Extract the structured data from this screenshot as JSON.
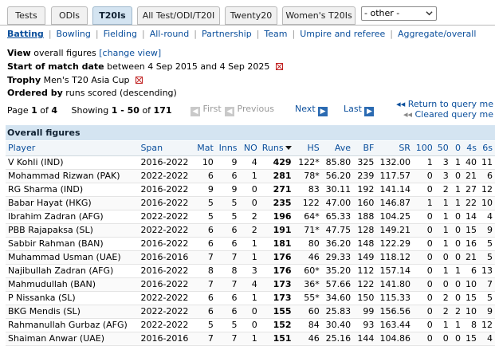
{
  "tabs": [
    {
      "label": "Tests",
      "active": false
    },
    {
      "label": "ODIs",
      "active": false
    },
    {
      "label": "T20Is",
      "active": true
    },
    {
      "label": "All Test/ODI/T20I",
      "active": false
    },
    {
      "label": "Twenty20",
      "active": false
    },
    {
      "label": "Women's T20Is",
      "active": false
    }
  ],
  "other_select": {
    "value": "- other -"
  },
  "subnav": [
    "Batting",
    "Bowling",
    "Fielding",
    "All-round",
    "Partnership",
    "Team",
    "Umpire and referee",
    "Aggregate/overall"
  ],
  "filters": {
    "view_label": "View",
    "view_value": "overall figures",
    "change_view": "[change view]",
    "start_label": "Start of match date",
    "start_value": "between 4 Sep 2015 and 4 Sep 2025",
    "trophy_label": "Trophy",
    "trophy_value": "Men's T20 Asia Cup",
    "ordered_label": "Ordered by",
    "ordered_value": "runs scored (descending)"
  },
  "pager": {
    "page_word": "Page",
    "page": "1",
    "of_word": "of",
    "pages": "4",
    "showing_word": "Showing",
    "range": "1 - 50",
    "total": "171",
    "first": "First",
    "previous": "Previous",
    "next": "Next",
    "last": "Last",
    "return_query": "Return to query me",
    "cleared_query": "Cleared query me"
  },
  "table": {
    "title": "Overall figures",
    "columns": [
      "Player",
      "Span",
      "Mat",
      "Inns",
      "NO",
      "Runs",
      "HS",
      "Ave",
      "BF",
      "SR",
      "100",
      "50",
      "0",
      "4s",
      "6s"
    ],
    "rows": [
      [
        "V Kohli (IND)",
        "2016-2022",
        "10",
        "9",
        "4",
        "429",
        "122*",
        "85.80",
        "325",
        "132.00",
        "1",
        "3",
        "1",
        "40",
        "11"
      ],
      [
        "Mohammad Rizwan (PAK)",
        "2022-2022",
        "6",
        "6",
        "1",
        "281",
        "78*",
        "56.20",
        "239",
        "117.57",
        "0",
        "3",
        "0",
        "21",
        "6"
      ],
      [
        "RG Sharma (IND)",
        "2016-2022",
        "9",
        "9",
        "0",
        "271",
        "83",
        "30.11",
        "192",
        "141.14",
        "0",
        "2",
        "1",
        "27",
        "12"
      ],
      [
        "Babar Hayat (HKG)",
        "2016-2022",
        "5",
        "5",
        "0",
        "235",
        "122",
        "47.00",
        "160",
        "146.87",
        "1",
        "1",
        "1",
        "22",
        "10"
      ],
      [
        "Ibrahim Zadran (AFG)",
        "2022-2022",
        "5",
        "5",
        "2",
        "196",
        "64*",
        "65.33",
        "188",
        "104.25",
        "0",
        "1",
        "0",
        "14",
        "4"
      ],
      [
        "PBB Rajapaksa (SL)",
        "2022-2022",
        "6",
        "6",
        "2",
        "191",
        "71*",
        "47.75",
        "128",
        "149.21",
        "0",
        "1",
        "0",
        "15",
        "9"
      ],
      [
        "Sabbir Rahman (BAN)",
        "2016-2022",
        "6",
        "6",
        "1",
        "181",
        "80",
        "36.20",
        "148",
        "122.29",
        "0",
        "1",
        "0",
        "16",
        "5"
      ],
      [
        "Muhammad Usman (UAE)",
        "2016-2016",
        "7",
        "7",
        "1",
        "176",
        "46",
        "29.33",
        "149",
        "118.12",
        "0",
        "0",
        "0",
        "21",
        "5"
      ],
      [
        "Najibullah Zadran (AFG)",
        "2016-2022",
        "8",
        "8",
        "3",
        "176",
        "60*",
        "35.20",
        "112",
        "157.14",
        "0",
        "1",
        "1",
        "6",
        "13"
      ],
      [
        "Mahmudullah (BAN)",
        "2016-2022",
        "7",
        "7",
        "4",
        "173",
        "36*",
        "57.66",
        "122",
        "141.80",
        "0",
        "0",
        "0",
        "10",
        "7"
      ],
      [
        "P Nissanka (SL)",
        "2022-2022",
        "6",
        "6",
        "1",
        "173",
        "55*",
        "34.60",
        "150",
        "115.33",
        "0",
        "2",
        "0",
        "15",
        "5"
      ],
      [
        "BKG Mendis (SL)",
        "2022-2022",
        "6",
        "6",
        "0",
        "155",
        "60",
        "25.83",
        "99",
        "156.56",
        "0",
        "2",
        "2",
        "10",
        "9"
      ],
      [
        "Rahmanullah Gurbaz (AFG)",
        "2022-2022",
        "5",
        "5",
        "0",
        "152",
        "84",
        "30.40",
        "93",
        "163.44",
        "0",
        "1",
        "1",
        "8",
        "12"
      ],
      [
        "Shaiman Anwar (UAE)",
        "2016-2016",
        "7",
        "7",
        "1",
        "151",
        "46",
        "25.16",
        "144",
        "104.86",
        "0",
        "0",
        "0",
        "15",
        "4"
      ]
    ]
  }
}
